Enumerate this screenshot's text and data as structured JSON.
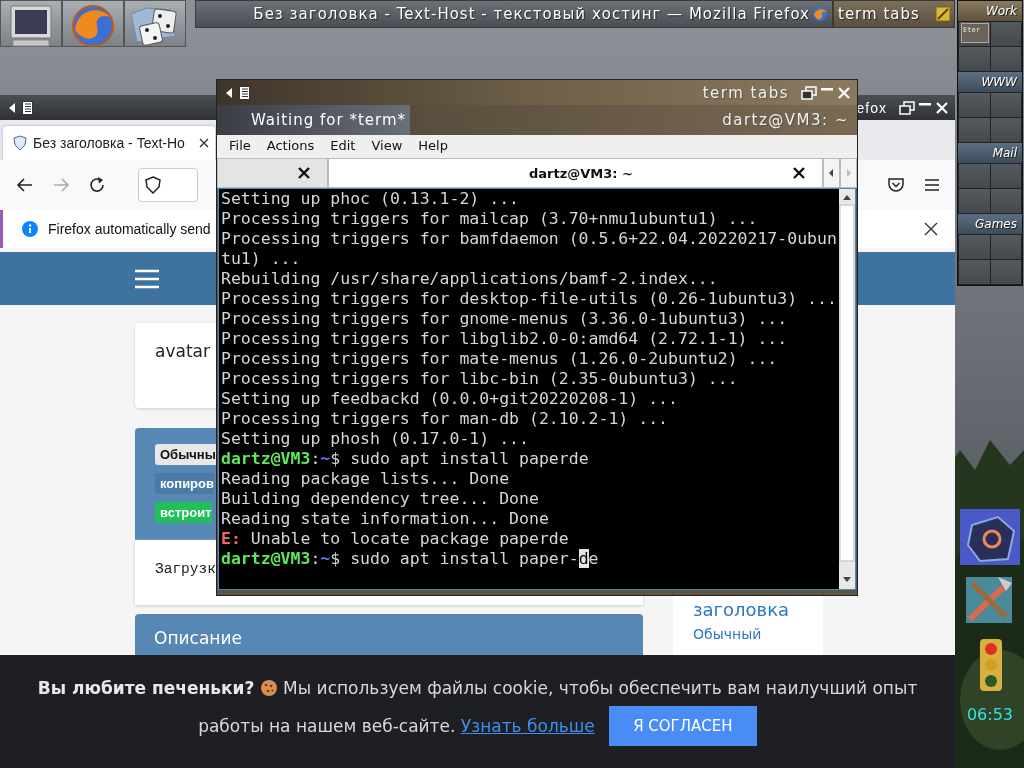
{
  "taskbar": [
    {
      "title": "Без заголовка - Text-Host - текстовый хостинг — Mozilla Firefox",
      "kind": "browser"
    },
    {
      "title": "term tabs",
      "kind": "terminal"
    }
  ],
  "pager": {
    "desks": [
      {
        "name": "Work",
        "selected": true,
        "windows": [
          "Eter"
        ]
      },
      {
        "name": "WWW",
        "selected": false
      },
      {
        "name": "Mail",
        "selected": false
      },
      {
        "name": "Games",
        "selected": false
      }
    ]
  },
  "clock": "06:53",
  "browser": {
    "title": "efox",
    "tab": {
      "label": "Без заголовка - Text-Ho",
      "selected": true
    },
    "forward_disabled": true,
    "notification": "Firefox automatically send",
    "page": {
      "avatar": "avatar",
      "badges": [
        {
          "label": "Обычны",
          "kind": "plain"
        },
        {
          "label": "копиров",
          "kind": "copy"
        },
        {
          "label": "встроит",
          "kind": "embed"
        }
      ],
      "upload": "Загрузк",
      "description": "Описание",
      "sidebar": {
        "title": "заголовка",
        "link": "Обычный"
      }
    },
    "cookie": {
      "text": "**Вы любите печеньки?**",
      "rest": " Мы используем файлы cookie, чтобы обеспечить вам наилучший опыт",
      "rest2": "работы на нашем веб-сайте.",
      "link": "Узнать больше",
      "button": "Я СОГЛАСЕН"
    }
  },
  "terminal": {
    "title": "term tabs",
    "status": "Waiting for *term*",
    "subtitle": "dartz@VM3: ~",
    "menu": [
      "File",
      "Actions",
      "Edit",
      "View",
      "Help"
    ],
    "tabs": [
      {
        "selected": false
      },
      {
        "label": "dartz@VM3: ~",
        "selected": true
      }
    ],
    "lines": [
      {
        "kind": "output",
        "text": "Setting up phoc (0.13.1-2) ..."
      },
      {
        "kind": "output",
        "text": "Processing triggers for mailcap (3.70+nmu1ubuntu1) ..."
      },
      {
        "kind": "output",
        "text": "Processing triggers for bamfdaemon (0.5.6+22.04.20220217-0ubun"
      },
      {
        "kind": "output",
        "text": "tu1) ..."
      },
      {
        "kind": "output",
        "text": "Rebuilding /usr/share/applications/bamf-2.index..."
      },
      {
        "kind": "output",
        "text": "Processing triggers for desktop-file-utils (0.26-1ubuntu3) ..."
      },
      {
        "kind": "output",
        "text": "Processing triggers for gnome-menus (3.36.0-1ubuntu3) ..."
      },
      {
        "kind": "output",
        "text": "Processing triggers for libglib2.0-0:amd64 (2.72.1-1) ..."
      },
      {
        "kind": "output",
        "text": "Processing triggers for mate-menus (1.26.0-2ubuntu2) ..."
      },
      {
        "kind": "output",
        "text": "Processing triggers for libc-bin (2.35-0ubuntu3) ..."
      },
      {
        "kind": "output",
        "text": "Setting up feedbackd (0.0.0+git20220208-1) ..."
      },
      {
        "kind": "output",
        "text": "Processing triggers for man-db (2.10.2-1) ..."
      },
      {
        "kind": "output",
        "text": "Setting up phosh (0.17.0-1) ..."
      },
      {
        "kind": "prompt",
        "user": "dartz@VM3",
        "sep": ":",
        "path": "~",
        "text": "$ sudo apt install paperde"
      },
      {
        "kind": "output",
        "text": "Reading package lists... Done"
      },
      {
        "kind": "output",
        "text": "Building dependency tree... Done"
      },
      {
        "kind": "output",
        "text": "Reading state information... Done"
      },
      {
        "kind": "error",
        "prefix": "E:",
        "text": " Unable to locate package paperde"
      },
      {
        "kind": "prompt",
        "user": "dartz@VM3",
        "sep": ":",
        "path": "~",
        "text": "$ sudo apt install paper-",
        "cursor": "d",
        "after": "e"
      }
    ]
  }
}
